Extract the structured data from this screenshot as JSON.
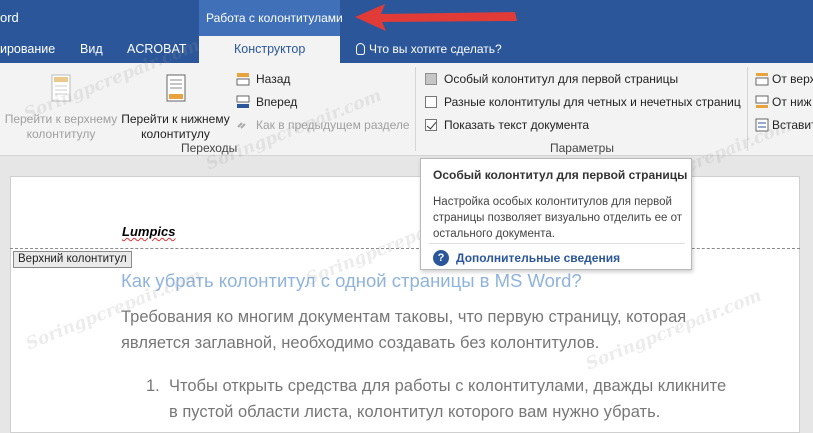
{
  "title_bar": {
    "app_title": "ord",
    "context_group": "Работа с колонтитулами"
  },
  "tabs": [
    {
      "label": "ирование"
    },
    {
      "label": "Вид"
    },
    {
      "label": "ACROBAT"
    },
    {
      "label": "Конструктор",
      "active": true
    }
  ],
  "tell_me": "Что вы хотите сделать?",
  "ribbon": {
    "nav_group": {
      "go_header": "Перейти к верхнему\nколонтитулу",
      "go_footer": "Перейти к нижнему\nколонтитулу",
      "back": "Назад",
      "forward": "Вперед",
      "link_previous": "Как в предыдущем разделе",
      "label": "Переходы"
    },
    "options_group": {
      "different_first": "Особый колонтитул для первой страницы",
      "odd_even": "Разные колонтитулы для четных и нечетных страниц",
      "show_text": "Показать текст документа",
      "label": "Параметры"
    },
    "position_group": {
      "from_top": "От верх",
      "from_bottom": "От ниж",
      "insert": "Вставит"
    }
  },
  "tooltip": {
    "title": "Особый колонтитул для первой страницы",
    "body": "Настройка особых колонтитулов для первой страницы позволяет визуально отделить ее от остального документа.",
    "link": "Дополнительные сведения"
  },
  "document": {
    "header_text": "Lumpics",
    "header_tag": "Верхний колонтитул",
    "heading": "Как убрать колонтитул с одной страницы в MS Word?",
    "para_line1": "Требования ко многим документам таковы, что первую страницу, которая",
    "para_line2": "является заглавной, необходимо создавать без колонтитулов.",
    "list_num": "1.",
    "list_line1": "Чтобы открыть средства для работы с колонтитулами, дважды кликните",
    "list_line2": "в пустой области листа, колонтитул которого вам нужно убрать."
  },
  "watermark": "Soringpcrepair.com",
  "colors": {
    "brand": "#2b579a",
    "arrow": "#e03b36"
  }
}
